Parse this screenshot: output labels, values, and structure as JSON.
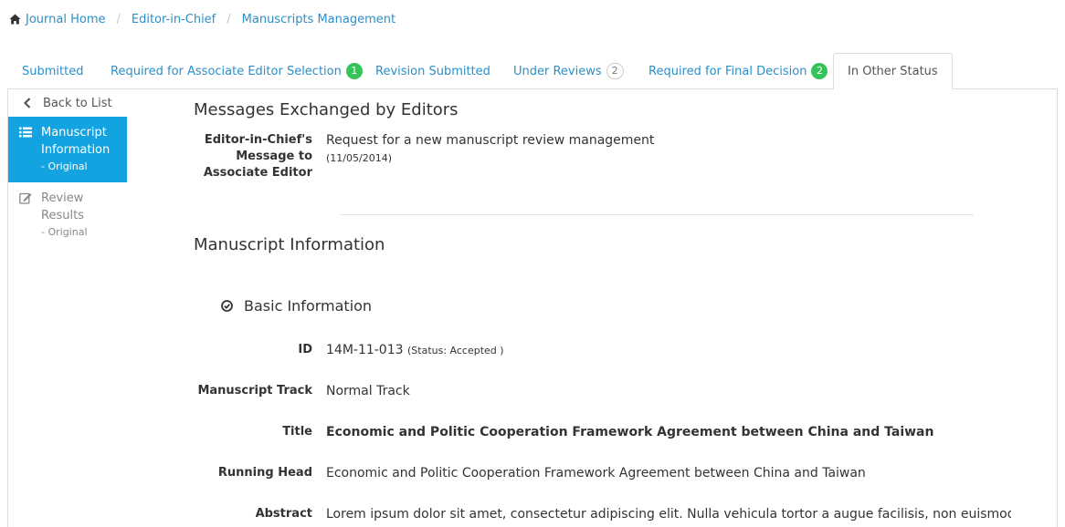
{
  "breadcrumb": {
    "items": [
      "Journal Home",
      "Editor-in-Chief",
      "Manuscripts Management"
    ],
    "separator": "/"
  },
  "tabs": [
    {
      "label": "Submitted",
      "badge": null
    },
    {
      "label": "Required for Associate Editor Selection",
      "badge": "1",
      "badge_style": "green"
    },
    {
      "label": "Revision Submitted",
      "badge": null
    },
    {
      "label": "Under Reviews",
      "badge": "2",
      "badge_style": "white"
    },
    {
      "label": "Required for Final Decision",
      "badge": "2",
      "badge_style": "green"
    },
    {
      "label": "In Other Status",
      "badge": null,
      "active": true
    }
  ],
  "sidenav": {
    "back_label": "Back to List",
    "items": [
      {
        "label": "Manuscript Information",
        "sub": "- Original",
        "icon": "list-icon",
        "active": true
      },
      {
        "label": "Review Results",
        "sub": "- Original",
        "icon": "edit-icon",
        "active": false
      }
    ]
  },
  "messages": {
    "heading": "Messages Exchanged by Editors",
    "label": "Editor-in-Chief's Message to Associate Editor",
    "text": "Request for a new manuscript review management",
    "date": "(11/05/2014)"
  },
  "manuscript": {
    "heading": "Manuscript Information",
    "basic_heading": "Basic Information",
    "fields": {
      "id_label": "ID",
      "id_value": "14M-11-013",
      "id_status": "(Status: Accepted )",
      "track_label": "Manuscript Track",
      "track_value": "Normal Track",
      "title_label": "Title",
      "title_value": "Economic and Politic Cooperation Framework Agreement between China and Taiwan",
      "running_head_label": "Running Head",
      "running_head_value": "Economic and Politic Cooperation Framework Agreement between China and Taiwan",
      "abstract_label": "Abstract",
      "abstract_value": "Lorem ipsum dolor sit amet, consectetur adipiscing elit. Nulla vehicula tortor a augue facilisis, non euismod"
    }
  },
  "colors": {
    "link": "#2a8fc9",
    "active_nav": "#12a3e0",
    "badge_green": "#36c45a"
  }
}
